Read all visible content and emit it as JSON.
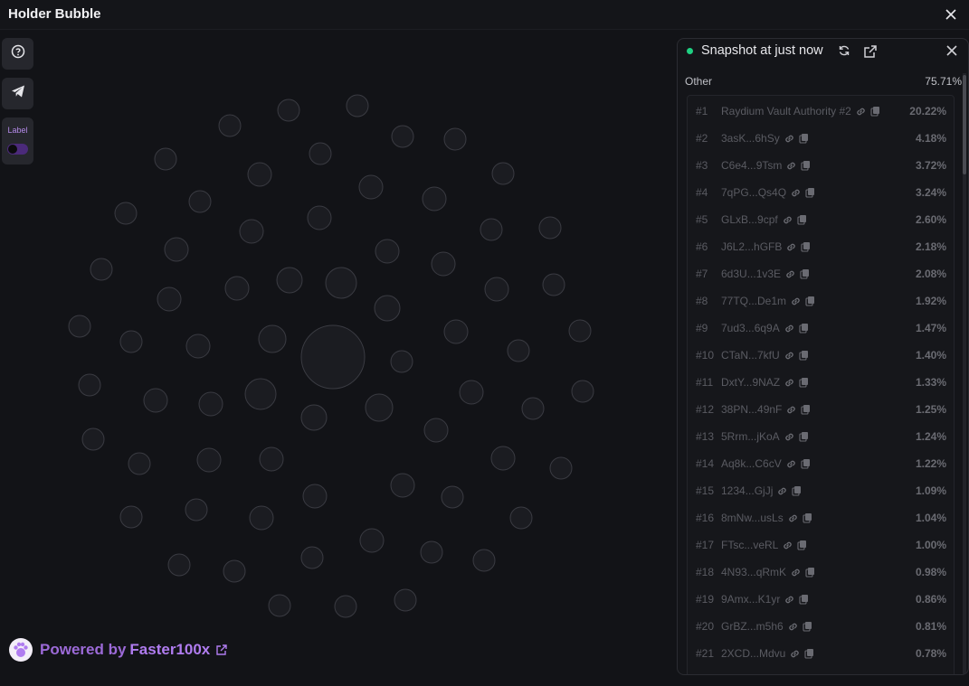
{
  "window": {
    "title": "Holder Bubble"
  },
  "toolbar": {
    "label_text": "Label"
  },
  "footer": {
    "powered_prefix": "Powered by",
    "brand": "Faster100x"
  },
  "panel": {
    "snapshot_text": "Snapshot at just now",
    "other_label": "Other",
    "other_value": "75.71%",
    "holders": [
      {
        "rank": "#1",
        "name": "Raydium Vault Authority #2",
        "pct": "20.22%"
      },
      {
        "rank": "#2",
        "name": "3asK...6hSy",
        "pct": "4.18%"
      },
      {
        "rank": "#3",
        "name": "C6e4...9Tsm",
        "pct": "3.72%"
      },
      {
        "rank": "#4",
        "name": "7qPG...Qs4Q",
        "pct": "3.24%"
      },
      {
        "rank": "#5",
        "name": "GLxB...9cpf",
        "pct": "2.60%"
      },
      {
        "rank": "#6",
        "name": "J6L2...hGFB",
        "pct": "2.18%"
      },
      {
        "rank": "#7",
        "name": "6d3U...1v3E",
        "pct": "2.08%"
      },
      {
        "rank": "#8",
        "name": "77TQ...De1m",
        "pct": "1.92%"
      },
      {
        "rank": "#9",
        "name": "7ud3...6q9A",
        "pct": "1.47%"
      },
      {
        "rank": "#10",
        "name": "CTaN...7kfU",
        "pct": "1.40%"
      },
      {
        "rank": "#11",
        "name": "DxtY...9NAZ",
        "pct": "1.33%"
      },
      {
        "rank": "#12",
        "name": "38PN...49nF",
        "pct": "1.25%"
      },
      {
        "rank": "#13",
        "name": "5Rrm...jKoA",
        "pct": "1.24%"
      },
      {
        "rank": "#14",
        "name": "Aq8k...C6cV",
        "pct": "1.22%"
      },
      {
        "rank": "#15",
        "name": "1234...GjJj",
        "pct": "1.09%"
      },
      {
        "rank": "#16",
        "name": "8mNw...usLs",
        "pct": "1.04%"
      },
      {
        "rank": "#17",
        "name": "FTsc...veRL",
        "pct": "1.00%"
      },
      {
        "rank": "#18",
        "name": "4N93...qRmK",
        "pct": "0.98%"
      },
      {
        "rank": "#19",
        "name": "9Amx...K1yr",
        "pct": "0.86%"
      },
      {
        "rank": "#20",
        "name": "GrBZ...m5h6",
        "pct": "0.81%"
      },
      {
        "rank": "#21",
        "name": "2XCD...Mdvu",
        "pct": "0.78%"
      }
    ]
  },
  "colors": {
    "accent": "#9c6ad8",
    "live_dot": "#1fd082",
    "background": "#121317"
  },
  "icons": [
    "help-icon",
    "telegram-icon",
    "close-icon",
    "refresh-icon",
    "external-link-icon",
    "link-icon",
    "copy-icon",
    "paw-logo-icon"
  ]
}
